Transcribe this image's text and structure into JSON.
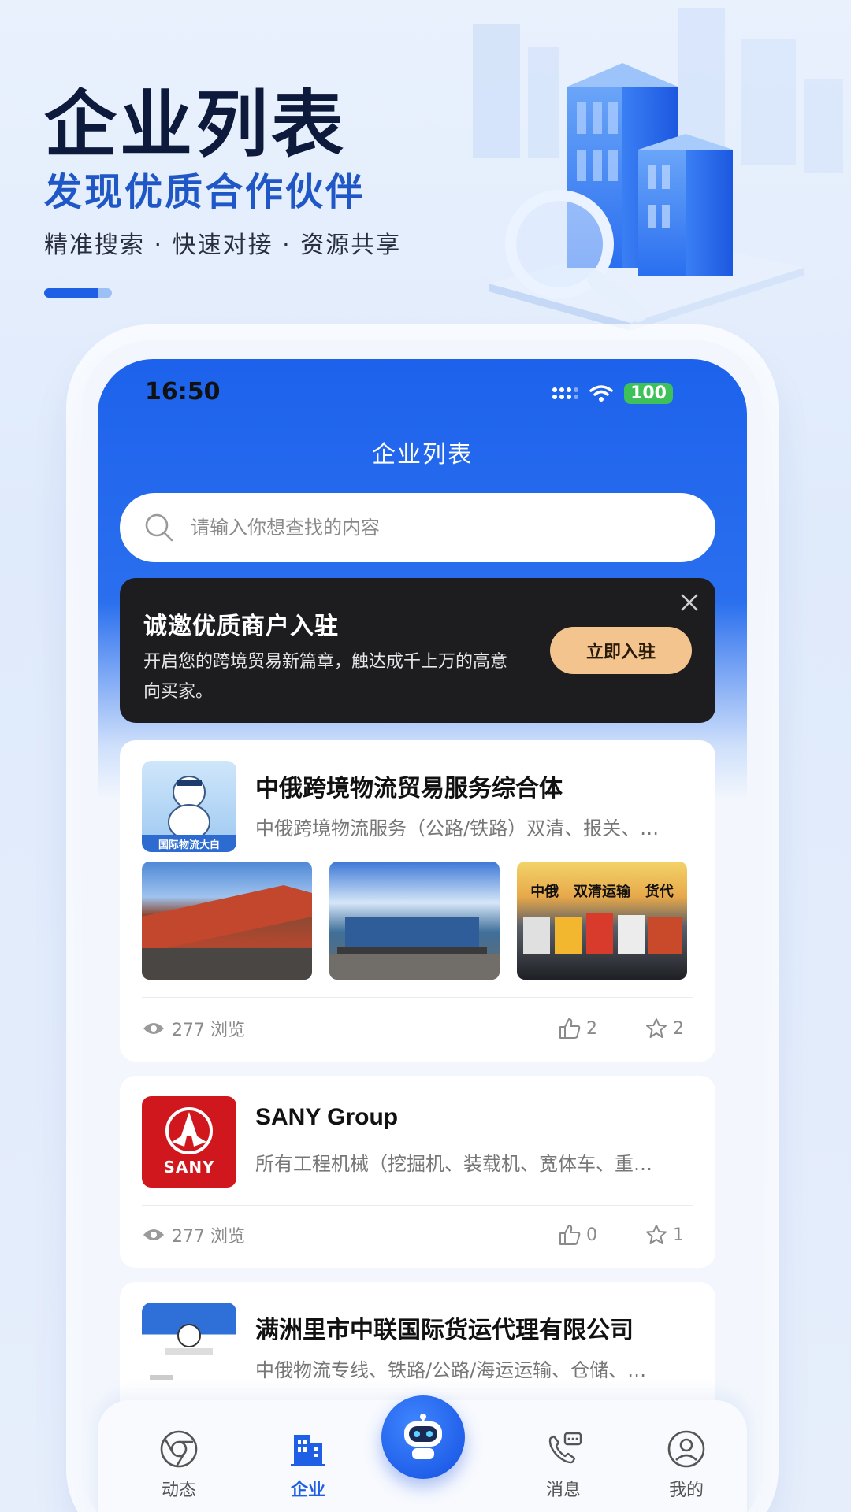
{
  "hero": {
    "title": "企业列表",
    "subtitle": "发现优质合作伙伴",
    "tags": "精准搜索 · 快速对接 · 资源共享"
  },
  "status_bar": {
    "time": "16:50",
    "battery": "100"
  },
  "nav": {
    "title": "企业列表"
  },
  "search": {
    "placeholder": "请输入你想查找的内容"
  },
  "banner": {
    "title": "诚邀优质商户入驻",
    "description": "开启您的跨境贸易新篇章，触达成千上万的高意向买家。",
    "button_label": "立即入驻"
  },
  "companies": [
    {
      "name": "中俄跨境物流贸易服务综合体",
      "description": "中俄跨境物流服务（公路/铁路）双清、报关、…",
      "logo_text": "国际物流大白",
      "thumb_caption": "中俄   双清运输   货代",
      "views": "277 浏览",
      "likes": "2",
      "favorites": "2"
    },
    {
      "name": "SANY Group",
      "description": "所有工程机械（挖掘机、装载机、宽体车、重…",
      "logo_text": "SANY",
      "views": "277 浏览",
      "likes": "0",
      "favorites": "1"
    },
    {
      "name": "满洲里市中联国际货运代理有限公司",
      "description": "中俄物流专线、铁路/公路/海运运输、仓储、…"
    }
  ],
  "tabbar": {
    "items": [
      {
        "label": "动态",
        "icon": "chrome-circle-icon"
      },
      {
        "label": "企业",
        "icon": "building-icon"
      },
      {
        "label": "",
        "icon": "robot-icon"
      },
      {
        "label": "消息",
        "icon": "phone-chat-icon"
      },
      {
        "label": "我的",
        "icon": "user-icon"
      }
    ]
  },
  "colors": {
    "brand_blue": "#1f5fe6",
    "banner_bg": "#1d1d1f",
    "banner_button": "#f3c48e",
    "sany_red": "#d0171d"
  }
}
